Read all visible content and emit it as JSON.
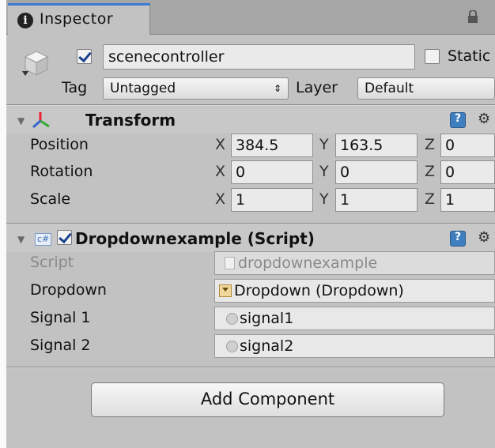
{
  "tab": {
    "title": "Inspector"
  },
  "gameobject": {
    "active": true,
    "name": "scenecontroller",
    "static_label": "Static",
    "static_checked": false,
    "tag_label": "Tag",
    "tag_value": "Untagged",
    "layer_label": "Layer",
    "layer_value": "Default"
  },
  "transform": {
    "title": "Transform",
    "rows": [
      {
        "label": "Position",
        "x": "384.5",
        "y": "163.5",
        "z": "0"
      },
      {
        "label": "Rotation",
        "x": "0",
        "y": "0",
        "z": "0"
      },
      {
        "label": "Scale",
        "x": "1",
        "y": "1",
        "z": "1"
      }
    ],
    "axis": {
      "x": "X",
      "y": "Y",
      "z": "Z"
    }
  },
  "script_component": {
    "enabled": true,
    "badge": "c#",
    "title": "Dropdownexample (Script)",
    "fields": [
      {
        "label": "Script",
        "value": "dropdownexample"
      },
      {
        "label": "Dropdown",
        "value": "Dropdown (Dropdown)"
      },
      {
        "label": "Signal 1",
        "value": "signal1"
      },
      {
        "label": "Signal 2",
        "value": "signal2"
      }
    ]
  },
  "add_component": {
    "label": "Add Component"
  },
  "colors": {
    "panel": "#c2c2c2",
    "tab_accent": "#3b7bd6",
    "check": "#1a3f8c"
  }
}
